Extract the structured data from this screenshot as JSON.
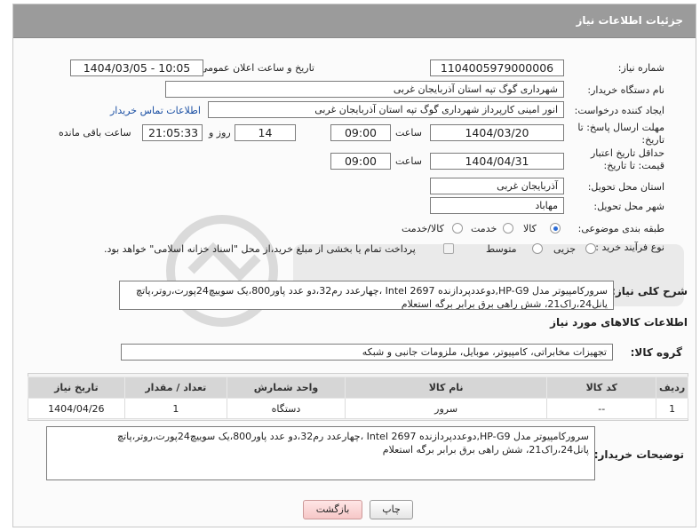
{
  "header": {
    "title": "جزئیات اطلاعات نیاز"
  },
  "fields": {
    "need_number": {
      "label": "شماره نیاز:",
      "value": "1104005979000006"
    },
    "announce_datetime": {
      "label": "تاریخ و ساعت اعلان عمومی:",
      "value": "1404/03/05 - 10:05"
    },
    "buyer_org": {
      "label": "نام دستگاه خریدار:",
      "value": "شهرداری گوگ تپه استان آذربایجان غربی"
    },
    "requester": {
      "label": "ایجاد کننده درخواست:",
      "value": "انور امینی کارپرداز شهرداری گوگ تپه استان آذربایجان غربی",
      "contact_link": "اطلاعات تماس خریدار"
    },
    "send_deadline": {
      "label": "مهلت ارسال پاسخ: تا تاریخ:",
      "date": "1404/03/20",
      "time_label": "ساعت",
      "time": "09:00",
      "days": "14",
      "days_label": "روز و",
      "remaining": "21:05:33",
      "remaining_label": "ساعت باقی مانده"
    },
    "price_validity": {
      "label": "حداقل تاریخ اعتبار قیمت: تا تاریخ:",
      "date": "1404/04/31",
      "time_label": "ساعت",
      "time": "09:00"
    },
    "delivery_province": {
      "label": "استان محل تحویل:",
      "value": "آذربایجان غربی"
    },
    "delivery_city": {
      "label": "شهر محل تحویل:",
      "value": "مهاباد"
    },
    "category": {
      "label": "طبقه بندی موضوعی:",
      "options": [
        "کالا",
        "خدمت",
        "کالا/خدمت"
      ],
      "selected": "کالا"
    },
    "process_type": {
      "label": "نوع فرآیند خرید :",
      "options": [
        "جزیی",
        "متوسط"
      ],
      "selected": "",
      "payment_note": "پرداخت تمام یا بخشی از مبلغ خرید،از محل \"اسناد خزانه اسلامی\" خواهد بود."
    }
  },
  "summary": {
    "label": "شرح کلی نیاز:",
    "text": "سرورکامپیوتر مدل HP-G9,دوعددپردازنده Intel 2697 ،چهارعدد رم32،دو عدد پاور800،یک سوییچ24پورت،روتر،پاتچ پانل24،راک21، شش راهی برق برابر برگه استعلام"
  },
  "goods_info": {
    "title": "اطلاعات کالاهای مورد نیاز",
    "group_label": "گروه کالا:",
    "group_value": "تجهیزات مخابراتی، کامپیوتر، موبایل، ملزومات جانبی و شبکه"
  },
  "table": {
    "headers": [
      "ردیف",
      "کد کالا",
      "نام کالا",
      "واحد شمارش",
      "تعداد / مقدار",
      "تاریخ نیاز"
    ],
    "rows": [
      [
        "1",
        "--",
        "سرور",
        "دستگاه",
        "1",
        "1404/04/26"
      ]
    ]
  },
  "buyer_notes": {
    "label": "توضیحات خریدار:",
    "text": "سرورکامپیوتر مدل HP-G9,دوعددپردازنده Intel 2697 ،چهارعدد رم32،دو عدد پاور800،یک سوییچ24پورت،روتر،پاتچ پانل24،راک21، شش راهی برق برابر برگه استعلام"
  },
  "buttons": {
    "print": "چاپ",
    "back": "بازگشت"
  },
  "colors": {
    "header_bg": "#9b9b9b",
    "link": "#1a4fa3",
    "watermark": "#d9d9d9"
  }
}
